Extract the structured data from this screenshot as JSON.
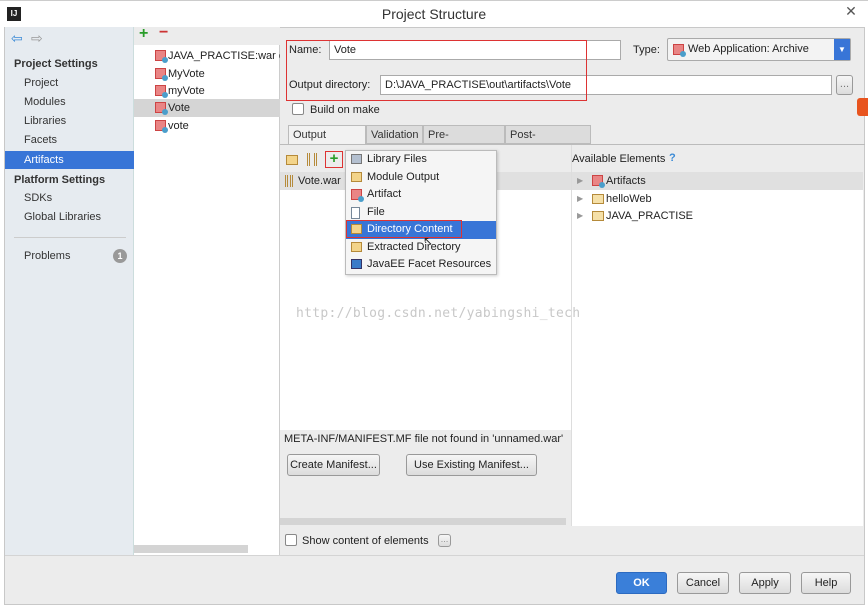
{
  "window": {
    "title": "Project Structure",
    "app_icon": "IJ"
  },
  "nav": {
    "back_icon": "arrow-left-icon",
    "forward_icon": "arrow-right-icon",
    "project_settings_header": "Project Settings",
    "project_items": [
      "Project",
      "Modules",
      "Libraries",
      "Facets",
      "Artifacts"
    ],
    "selected": "Artifacts",
    "platform_settings_header": "Platform Settings",
    "platform_items": [
      "SDKs",
      "Global Libraries"
    ],
    "problems_label": "Problems",
    "problems_count": "1"
  },
  "artifacts": {
    "add_label": "+",
    "remove_label": "−",
    "items": [
      "JAVA_PRACTISE:war ex",
      "MyVote",
      "myVote",
      "Vote",
      "vote"
    ],
    "selected": "Vote"
  },
  "form": {
    "name_label": "Name:",
    "name_value": "Vote",
    "type_label": "Type:",
    "type_value": "Web Application: Archive",
    "output_label": "Output directory:",
    "output_value": "D:\\JAVA_PRACTISE\\out\\artifacts\\Vote",
    "browse_label": "...",
    "build_on_make": "Build on make",
    "build_on_make_checked": false
  },
  "tabs": [
    "Output Layout",
    "Validation",
    "Pre-processing",
    "Post-processing"
  ],
  "active_tab": "Output Layout",
  "layout": {
    "root": "Vote.war",
    "available_header": "Available Elements",
    "help": "?",
    "available": [
      "Artifacts",
      "helloWeb",
      "JAVA_PRACTISE"
    ]
  },
  "menu": {
    "items": [
      "Library Files",
      "Module Output",
      "Artifact",
      "File",
      "Directory Content",
      "Extracted Directory",
      "JavaEE Facet Resources"
    ],
    "selected": "Directory Content"
  },
  "manifest": {
    "message": "META-INF/MANIFEST.MF file not found in 'unnamed.war'",
    "create": "Create Manifest...",
    "use_existing": "Use Existing Manifest..."
  },
  "show_content": "Show content of elements",
  "show_content_checked": false,
  "buttons": {
    "ok": "OK",
    "cancel": "Cancel",
    "apply": "Apply",
    "help": "Help"
  },
  "watermark": "http://blog.csdn.net/yabingshi_tech",
  "colors": {
    "accent": "#3875d7",
    "highlight_box": "#dd3333"
  }
}
